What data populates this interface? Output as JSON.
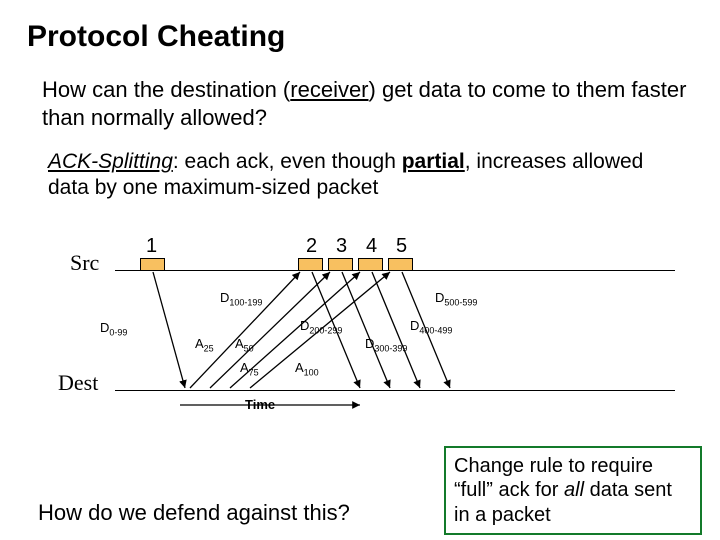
{
  "title": "Protocol Cheating",
  "question_pre": "How can the destination (",
  "question_receiver": "receiver",
  "question_post": ") get data to come to them faster than normally allowed?",
  "desc_term": "ACK-Splitting",
  "desc_mid1": ": each ack, even though ",
  "desc_partial": "partial",
  "desc_mid2": ", increases allowed data by one maximum-sized packet",
  "src_label": "Src",
  "dest_label": "Dest",
  "pkt_nums": {
    "n1": "1",
    "n2": "2",
    "n3": "3",
    "n4": "4",
    "n5": "5"
  },
  "data_labels": {
    "d0": "0-99",
    "d100": "100-199",
    "d200": "200-299",
    "d300": "300-399",
    "d400": "400-499",
    "d500": "500-599"
  },
  "ack_labels": {
    "a25": "25",
    "a50": "50",
    "a75": "75",
    "a100": "100"
  },
  "time_label": "Time",
  "defend_q": "How do we defend against this?",
  "callout_pre": "Change rule to require “full” ack for ",
  "callout_all": "all",
  "callout_post": " data sent in a packet",
  "colors": {
    "packet_fill": "#f8c060",
    "callout_border": "#137a2a"
  }
}
